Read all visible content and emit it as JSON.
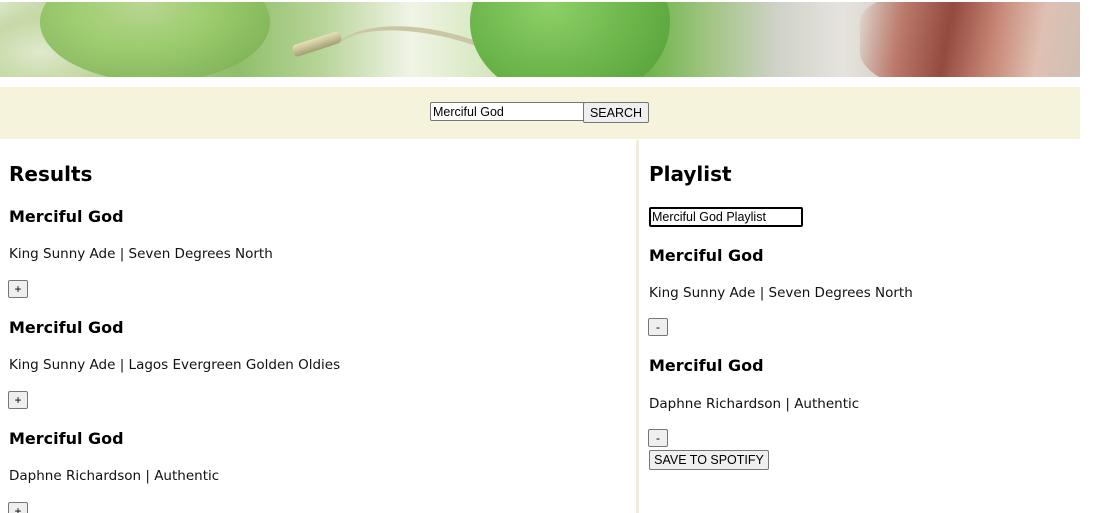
{
  "search": {
    "value": "Merciful God",
    "button_label": "SEARCH"
  },
  "results": {
    "heading": "Results",
    "tracks": [
      {
        "name": "Merciful God",
        "info": "King Sunny Ade | Seven Degrees North",
        "action": "+"
      },
      {
        "name": "Merciful God",
        "info": "King Sunny Ade | Lagos Evergreen Golden Oldies",
        "action": "+"
      },
      {
        "name": "Merciful God",
        "info": "Daphne Richardson | Authentic",
        "action": "+"
      }
    ]
  },
  "playlist": {
    "heading": "Playlist",
    "name_value": "Merciful God Playlist",
    "tracks": [
      {
        "name": "Merciful God",
        "info": "King Sunny Ade | Seven Degrees North",
        "action": "-"
      },
      {
        "name": "Merciful God",
        "info": "Daphne Richardson | Authentic",
        "action": "-"
      }
    ],
    "save_label": "SAVE TO SPOTIFY"
  }
}
